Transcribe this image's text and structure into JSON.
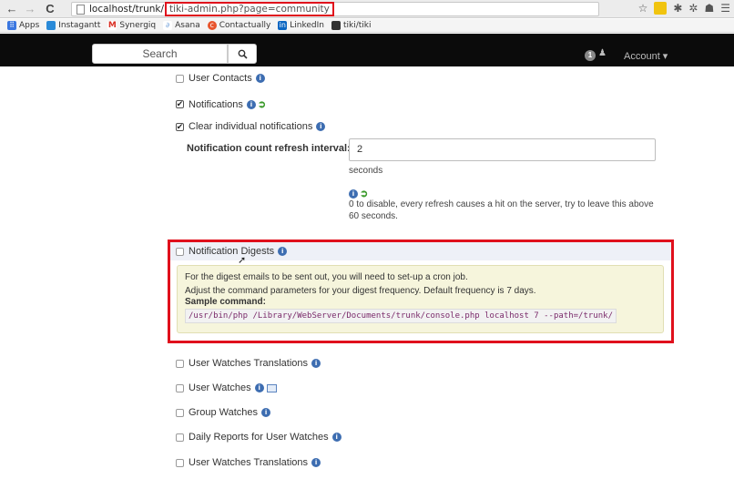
{
  "browser": {
    "url_host": "localhost/trunk/",
    "url_path": "tiki-admin.php?page=community",
    "bookmarks": [
      {
        "label": "Apps",
        "icon": "apps-grid-icon",
        "color": "#3b77e0"
      },
      {
        "label": "Instagantt",
        "icon": "instagantt-icon",
        "color": "#2a8ad8"
      },
      {
        "label": "Synergiq",
        "icon": "gmail-icon",
        "color": "#d93025"
      },
      {
        "label": "Asana",
        "icon": "asana-icon",
        "color": "#6a9cd8"
      },
      {
        "label": "Contactually",
        "icon": "contactually-icon",
        "color": "#e8542c"
      },
      {
        "label": "LinkedIn",
        "icon": "linkedin-icon",
        "color": "#0a66c2"
      },
      {
        "label": "tiki/tiki",
        "icon": "tiki-icon",
        "color": "#333333"
      }
    ]
  },
  "topbar": {
    "search_placeholder": "Search",
    "notif_count": "1",
    "account_label": "Account ▾"
  },
  "settings": {
    "user_contacts": "User Contacts",
    "notifications": "Notifications",
    "clear_notifications": "Clear individual notifications",
    "refresh_label": "Notification count refresh interval:",
    "refresh_value": "2",
    "refresh_unit": "seconds",
    "refresh_help_1": "0 to disable, every refresh causes a hit on the server, try to leave this above",
    "refresh_help_2": "60 seconds.",
    "digests": "Notification Digests",
    "digest_line1": "For the digest emails to be sent out, you will need to set-up a cron job.",
    "digest_line2": "Adjust the command parameters for your digest frequency. Default frequency is 7 days.",
    "sample_label": "Sample command:",
    "sample_command": "/usr/bin/php /Library/WebServer/Documents/trunk/console.php localhost 7 --path=/trunk/",
    "watches_translations": "User Watches Translations",
    "user_watches": "User Watches",
    "group_watches": "Group Watches",
    "daily_reports": "Daily Reports for User Watches",
    "watches_translations_2": "User Watches Translations"
  },
  "colors": {
    "highlight": "#e0101c",
    "info": "#3d6db1"
  }
}
